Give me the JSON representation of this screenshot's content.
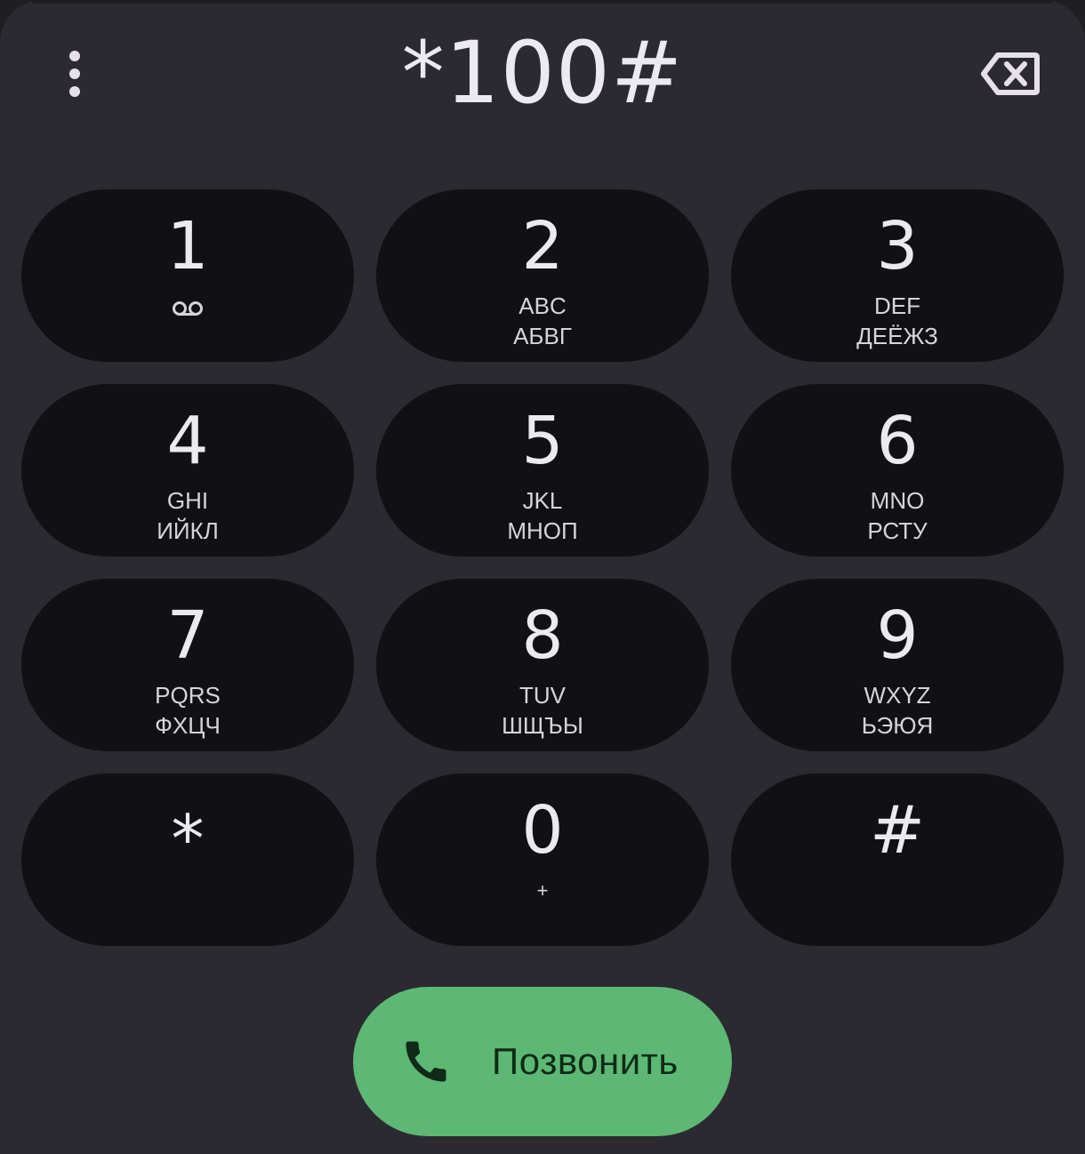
{
  "dialer": {
    "number": "*100#"
  },
  "icons": {
    "menu": "more-vert-icon",
    "backspace": "backspace-icon",
    "voicemail": "voicemail-icon",
    "call": "phone-icon"
  },
  "keypad": {
    "k1": {
      "digit": "1"
    },
    "k2": {
      "digit": "2",
      "latin": "ABC",
      "cyrillic": "АБВГ"
    },
    "k3": {
      "digit": "3",
      "latin": "DEF",
      "cyrillic": "ДЕЁЖЗ"
    },
    "k4": {
      "digit": "4",
      "latin": "GHI",
      "cyrillic": "ИЙКЛ"
    },
    "k5": {
      "digit": "5",
      "latin": "JKL",
      "cyrillic": "МНОП"
    },
    "k6": {
      "digit": "6",
      "latin": "MNO",
      "cyrillic": "РСТУ"
    },
    "k7": {
      "digit": "7",
      "latin": "PQRS",
      "cyrillic": "ФХЦЧ"
    },
    "k8": {
      "digit": "8",
      "latin": "TUV",
      "cyrillic": "ШЩЪЫ"
    },
    "k9": {
      "digit": "9",
      "latin": "WXYZ",
      "cyrillic": "ЬЭЮЯ"
    },
    "kstar": {
      "digit": "*"
    },
    "k0": {
      "digit": "0",
      "sub": "+"
    },
    "khash": {
      "digit": "#"
    }
  },
  "call": {
    "label": "Позвонить"
  },
  "colors": {
    "background": "#2b2a30",
    "key": "#111114",
    "call": "#5cb874",
    "text": "#eceaf0"
  }
}
